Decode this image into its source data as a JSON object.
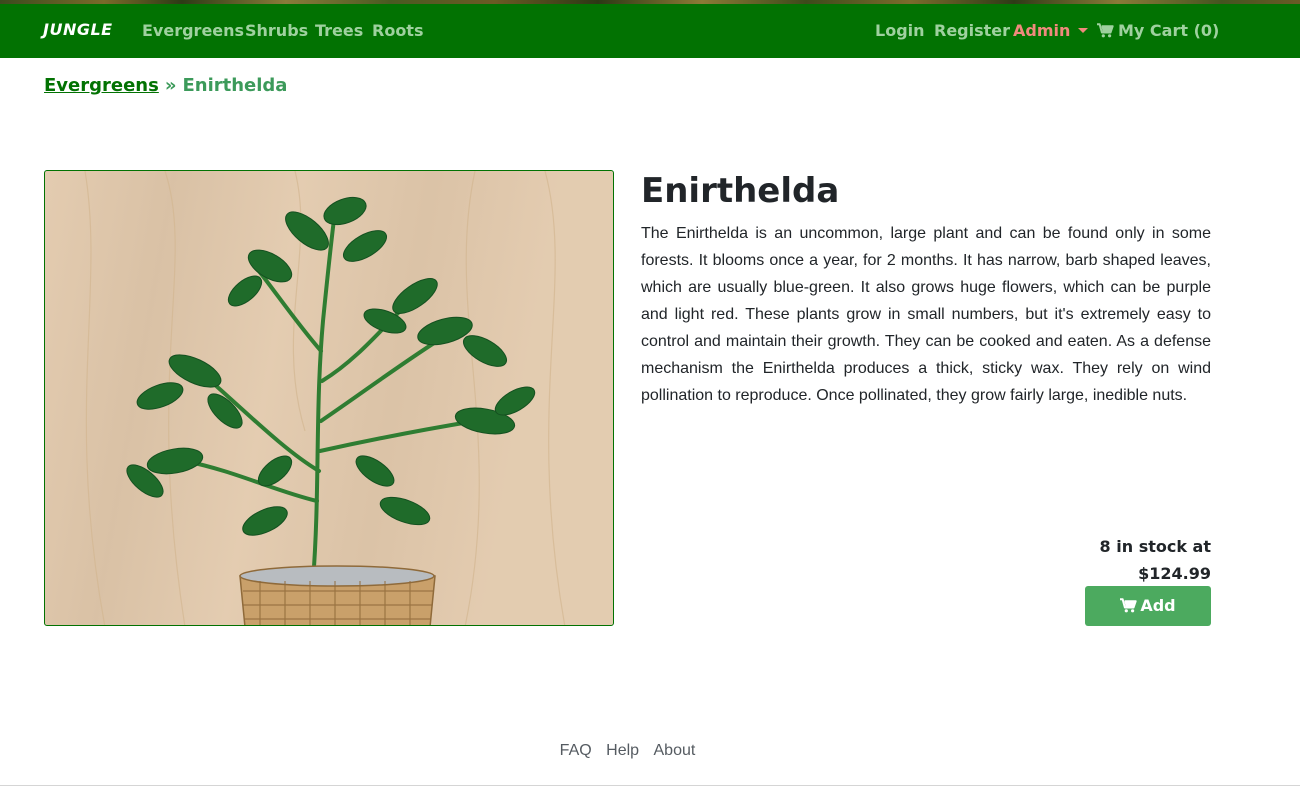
{
  "navbar": {
    "brand": "JUNGLE",
    "links": [
      {
        "label": "Evergreens"
      },
      {
        "label": "Shrubs"
      },
      {
        "label": "Trees"
      },
      {
        "label": "Roots"
      }
    ],
    "login": "Login",
    "register": "Register",
    "admin": "Admin",
    "cart": "My Cart (0)",
    "cart_icon": "shopping-cart-icon",
    "admin_color": "#f08a7d",
    "background": "#027202"
  },
  "breadcrumb": {
    "category": "Evergreens",
    "separator": "»",
    "current": "Enirthelda"
  },
  "product": {
    "name": "Enirthelda",
    "description": "The Enirthelda is an uncommon, large plant and can be found only in some forests. It blooms once a year, for 2 months. It has narrow, barb shaped leaves, which are usually blue-green. It also grows huge flowers, which can be purple and light red. These plants grow in small numbers, but it's extremely easy to control and maintain their growth. They can be cooked and eaten. As a defense mechanism the Enirthelda produces a thick, sticky wax. They rely on wind pollination to reproduce. Once pollinated, they grow fairly large, inedible nuts.",
    "stock_text": "8 in stock at",
    "price": "$124.99",
    "add_label": "Add",
    "add_color": "#4caa5f"
  },
  "footer": {
    "links": [
      {
        "label": "FAQ"
      },
      {
        "label": "Help"
      },
      {
        "label": "About"
      }
    ]
  }
}
